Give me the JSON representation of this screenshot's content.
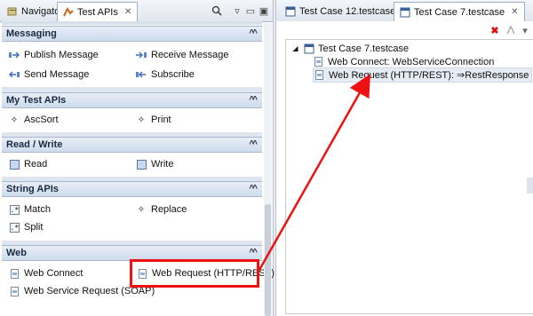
{
  "left_tabs": {
    "navigator": "Navigator",
    "test_apis": "Test APIs"
  },
  "sections": {
    "messaging": {
      "title": "Messaging",
      "items": [
        "Publish Message",
        "Receive Message",
        "Send Message",
        "Subscribe"
      ]
    },
    "my_test_apis": {
      "title": "My Test APIs",
      "items": [
        "AscSort",
        "Print"
      ]
    },
    "read_write": {
      "title": "Read / Write",
      "items": [
        "Read",
        "Write"
      ]
    },
    "string_apis": {
      "title": "String APIs",
      "items": [
        "Match",
        "Replace",
        "Split"
      ]
    },
    "web": {
      "title": "Web",
      "items": [
        "Web Connect",
        "Web Request (HTTP/REST)",
        "Web Service Request (SOAP)"
      ]
    }
  },
  "right_tabs": {
    "tab1": "Test Case 12.testcase",
    "tab2": "Test Case 7.testcase"
  },
  "tree": {
    "root": "Test Case 7.testcase",
    "children": [
      "Web Connect: WebServiceConnection",
      "Web Request (HTTP/REST): ⇒RestResponse"
    ]
  },
  "colors": {
    "highlight": "#ee1111",
    "section_header": "#cddbeb"
  }
}
